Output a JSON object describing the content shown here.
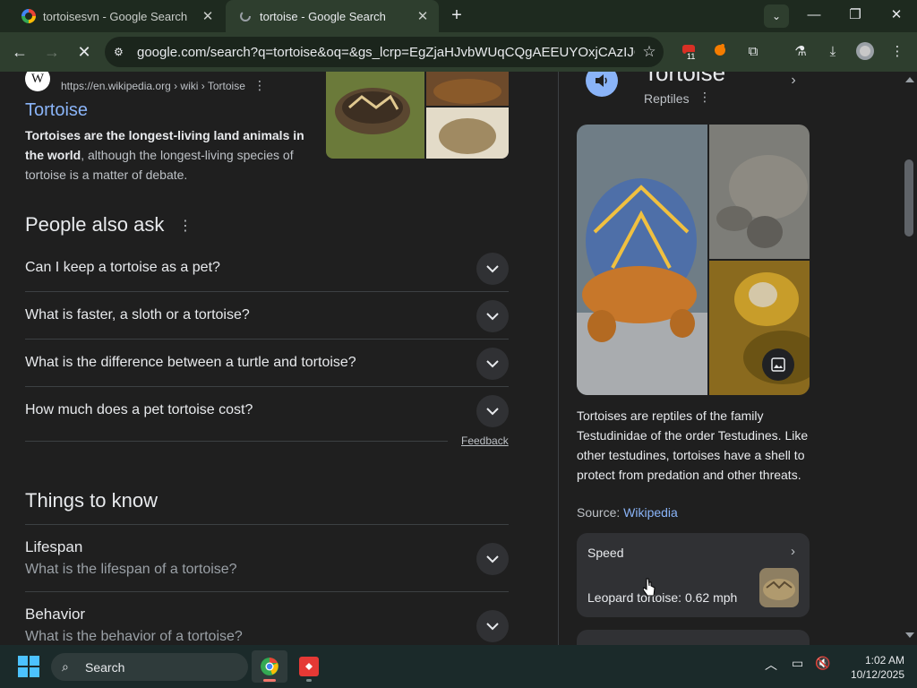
{
  "browser": {
    "tabs": [
      {
        "title": "tortoisesvn - Google Search",
        "active": false
      },
      {
        "title": "tortoise - Google Search",
        "active": true
      }
    ],
    "url": "google.com/search?q=tortoise&oq=&gs_lcrp=EgZjaHJvbWUqCQgAEEUYOxjCAzIJCAA...",
    "extension_badge": "11"
  },
  "result": {
    "url": "https://en.wikipedia.org › wiki › Tortoise",
    "title": "Tortoise",
    "snippet_bold": "Tortoises are the longest-living land animals in the world",
    "snippet_rest": ", although the longest-living species of tortoise is a matter of debate."
  },
  "paa": {
    "title": "People also ask",
    "questions": [
      "Can I keep a tortoise as a pet?",
      "What is faster, a sloth or a tortoise?",
      "What is the difference between a turtle and tortoise?",
      "How much does a pet tortoise cost?"
    ],
    "feedback": "Feedback"
  },
  "things_to_know": {
    "title": "Things to know",
    "items": [
      {
        "heading": "Lifespan",
        "sub": "What is the lifespan of a tortoise?"
      },
      {
        "heading": "Behavior",
        "sub": "What is the behavior of a tortoise?"
      }
    ]
  },
  "knowledge_panel": {
    "title": "Tortoise",
    "subtitle": "Reptiles",
    "description": "Tortoises are reptiles of the family Testudinidae of the order Testudines. Like other testudines, tortoises have a shell to protect from predation and other threats.",
    "source_label": "Source: ",
    "source_link": "Wikipedia",
    "card": {
      "label": "Speed",
      "value": "Leopard tortoise: 0.62 mph"
    }
  },
  "taskbar": {
    "search": "Search",
    "time": "1:02 AM",
    "date": "10/12/2025"
  }
}
